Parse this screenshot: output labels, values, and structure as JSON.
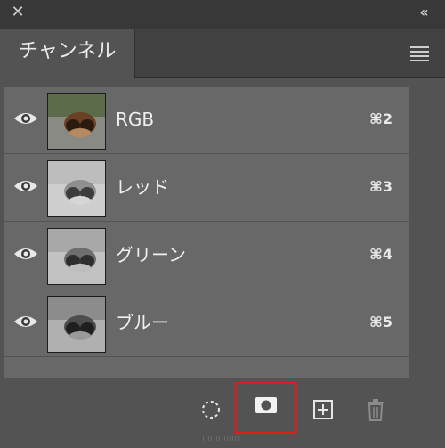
{
  "panel": {
    "tab_label": "チャンネル",
    "close_symbol": "✕",
    "collapse_symbol": "‹‹"
  },
  "channels": [
    {
      "label": "RGB",
      "shortcut": "⌘2",
      "thumbnail": "color"
    },
    {
      "label": "レッド",
      "shortcut": "⌘3",
      "thumbnail": "grayscale-light"
    },
    {
      "label": "グリーン",
      "shortcut": "⌘4",
      "thumbnail": "grayscale"
    },
    {
      "label": "ブルー",
      "shortcut": "⌘5",
      "thumbnail": "grayscale-dark"
    }
  ],
  "bottom_toolbar": {
    "buttons": [
      "load-channel-as-selection-icon",
      "save-selection-as-channel-icon",
      "new-channel-icon",
      "delete-channel-icon"
    ],
    "highlight_color": "#e01b1b"
  },
  "colors": {
    "panel_bg": "#535353",
    "row_bg": "#686868",
    "header_bg": "#383838"
  }
}
